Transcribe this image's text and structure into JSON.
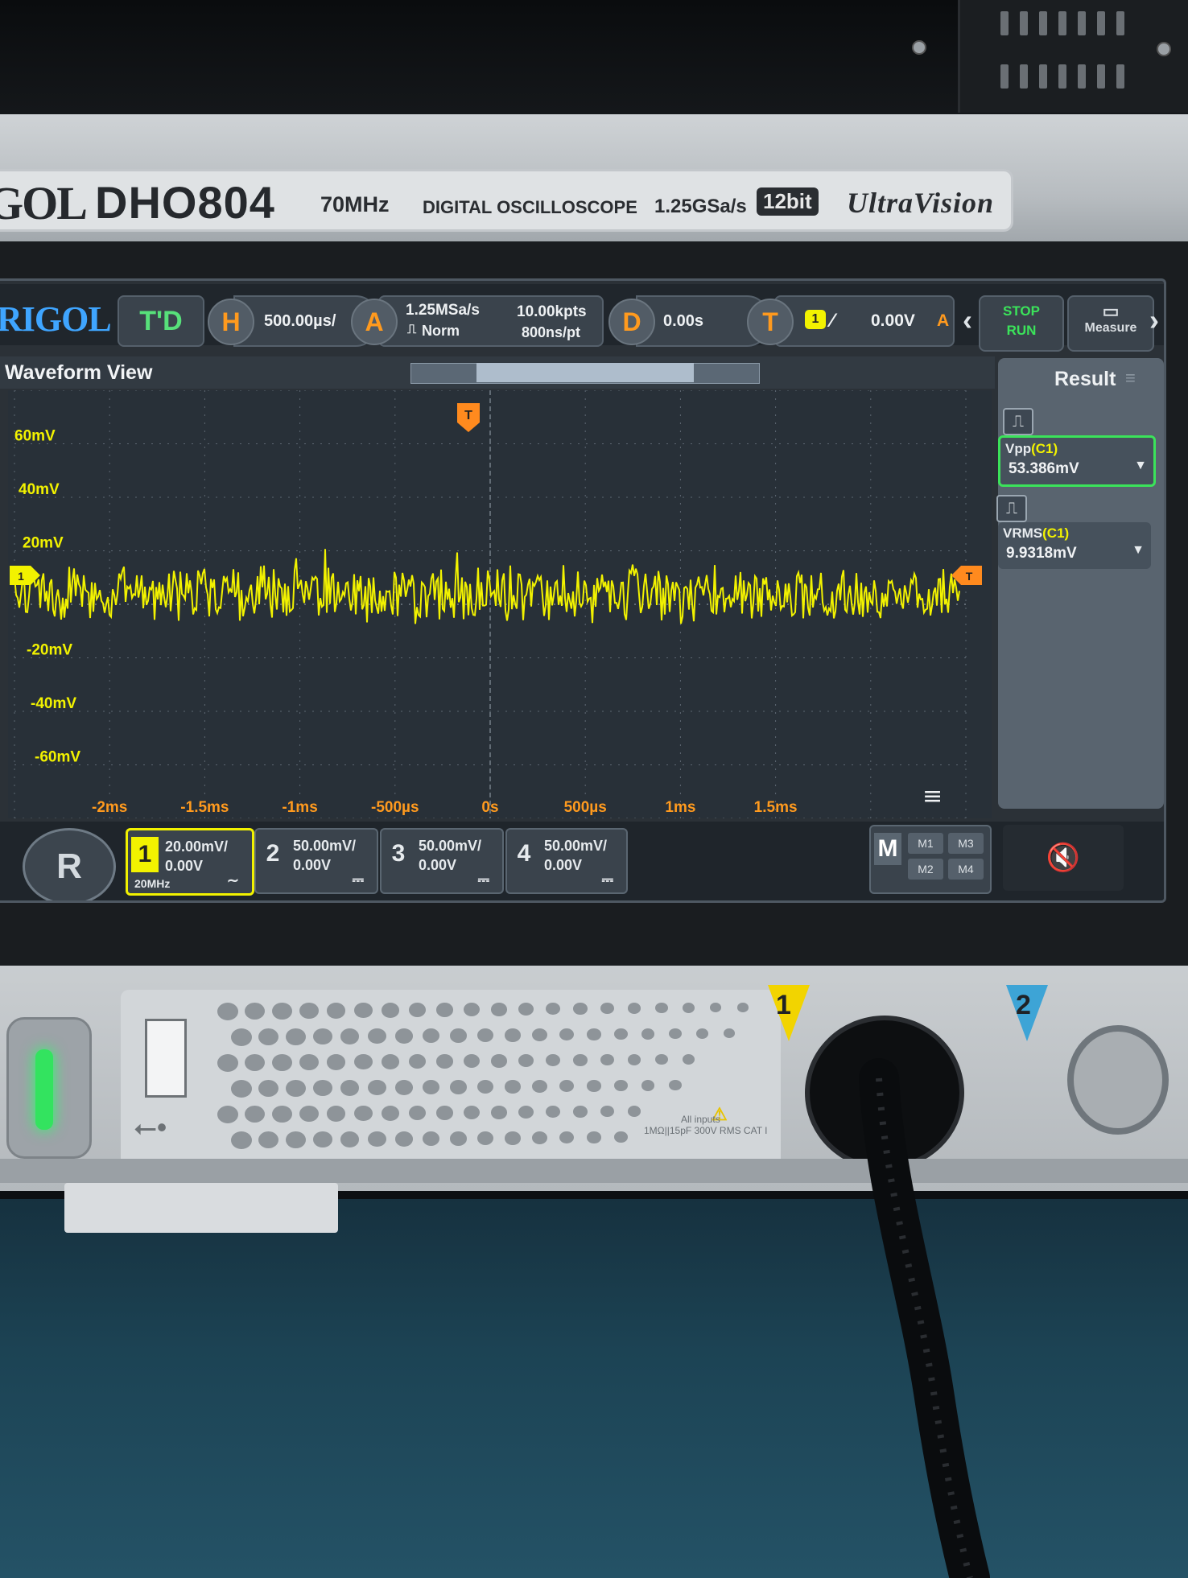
{
  "device": {
    "brand_partial": "GOL",
    "model": "DHO804",
    "bandwidth": "70MHz",
    "description": "DIGITAL OSCILLOSCOPE",
    "sample_rate": "1.25GSa/s",
    "bits": "12bit",
    "technology": "UltraVision"
  },
  "topbar": {
    "brand": "RIGOL",
    "mode": "T'D",
    "horizontal": {
      "label": "H",
      "scale": "500.00µs/"
    },
    "acquire": {
      "label": "A",
      "sample_rate": "1.25MSa/s",
      "memory": "10.00kpts",
      "mode": "Norm",
      "time_per_point": "800ns/pt"
    },
    "delay": {
      "label": "D",
      "value": "0.00s"
    },
    "trigger": {
      "label": "T",
      "source": "1",
      "level": "0.00V",
      "mode": "A"
    },
    "stop_run": {
      "stop": "STOP",
      "run": "RUN"
    },
    "measure_label": "Measure"
  },
  "waveform_view": {
    "title": "Waveform View",
    "y_labels": [
      "60mV",
      "40mV",
      "20mV",
      "-20mV",
      "-40mV",
      "-60mV"
    ],
    "x_labels": [
      "-2ms",
      "-1.5ms",
      "-1ms",
      "-500µs",
      "0s",
      "500µs",
      "1ms",
      "1.5ms"
    ],
    "trigger_marker": "T",
    "channel_marker": "1",
    "trigger_level_marker": "T"
  },
  "result_panel": {
    "title": "Result",
    "measurements": [
      {
        "name": "Vpp",
        "channel": "(C1)",
        "value": "53.386mV"
      },
      {
        "name": "VRMS",
        "channel": "(C1)",
        "value": "9.9318mV"
      }
    ]
  },
  "channels": [
    {
      "number": "1",
      "scale": "20.00mV/",
      "offset": "0.00V",
      "bw_limit": "20MHz",
      "coupling": "∼"
    },
    {
      "number": "2",
      "scale": "50.00mV/",
      "offset": "0.00V",
      "coupling": "⎓"
    },
    {
      "number": "3",
      "scale": "50.00mV/",
      "offset": "0.00V",
      "coupling": "⎓"
    },
    {
      "number": "4",
      "scale": "50.00mV/",
      "offset": "0.00V",
      "coupling": "⎓"
    }
  ],
  "math": {
    "label": "M",
    "items": [
      "M1",
      "M3",
      "M2",
      "M4"
    ]
  },
  "front_panel": {
    "ch1": "1",
    "ch2": "2",
    "warning_text": [
      "All inputs",
      "1MΩ||15pF 300V RMS CAT I"
    ]
  },
  "colors": {
    "ch1_yellow": "#f2f200",
    "trigger_orange": "#ff8a1e",
    "ui_blue": "#3fa5ff",
    "run_green": "#3be35a",
    "ch2_blue": "#3da4d6"
  },
  "icons": {
    "menu": "r-gear-icon",
    "sound": "speaker-mute-icon",
    "usb": "usb-icon",
    "collapse": "menu-collapse-icon"
  }
}
